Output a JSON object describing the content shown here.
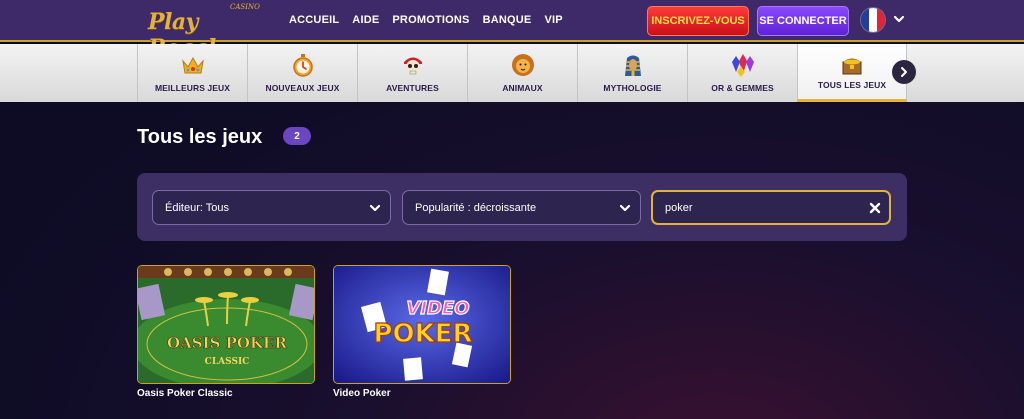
{
  "header": {
    "logo": "Play Regal",
    "logo_sub": "CASINO",
    "nav": [
      "ACCUEIL",
      "AIDE",
      "PROMOTIONS",
      "BANQUE",
      "VIP"
    ],
    "register_label": "INSCRIVEZ-VOUS",
    "login_label": "SE CONNECTER",
    "language_flag": "france-flag-icon"
  },
  "categories": [
    {
      "label": "MEILLEURS JEUX",
      "icon": "crown-icon"
    },
    {
      "label": "NOUVEAUX JEUX",
      "icon": "stopwatch-icon"
    },
    {
      "label": "AVENTURES",
      "icon": "pirate-skull-icon"
    },
    {
      "label": "ANIMAUX",
      "icon": "lion-icon"
    },
    {
      "label": "MYTHOLOGIE",
      "icon": "pharaoh-icon"
    },
    {
      "label": "OR & GEMMES",
      "icon": "gems-icon"
    },
    {
      "label": "TOUS LES JEUX",
      "icon": "treasure-chest-icon",
      "active": true
    }
  ],
  "page": {
    "title": "Tous les jeux",
    "count": "2"
  },
  "filters": {
    "publisher": "Éditeur: Tous",
    "sort": "Popularité : décroissante",
    "search_value": "poker"
  },
  "games": [
    {
      "title": "Oasis Poker Classic",
      "art_line1": "OASIS POKER",
      "art_line2": "CLASSIC"
    },
    {
      "title": "Video Poker",
      "art_line1": "VIDEO",
      "art_line2": "POKER"
    }
  ],
  "colors": {
    "header_bg": "#3e2a68",
    "accent_gold": "#e0b43a",
    "register_red": "#e0202a",
    "login_purple": "#7a3cf0",
    "panel_bg": "#3d2f63"
  }
}
